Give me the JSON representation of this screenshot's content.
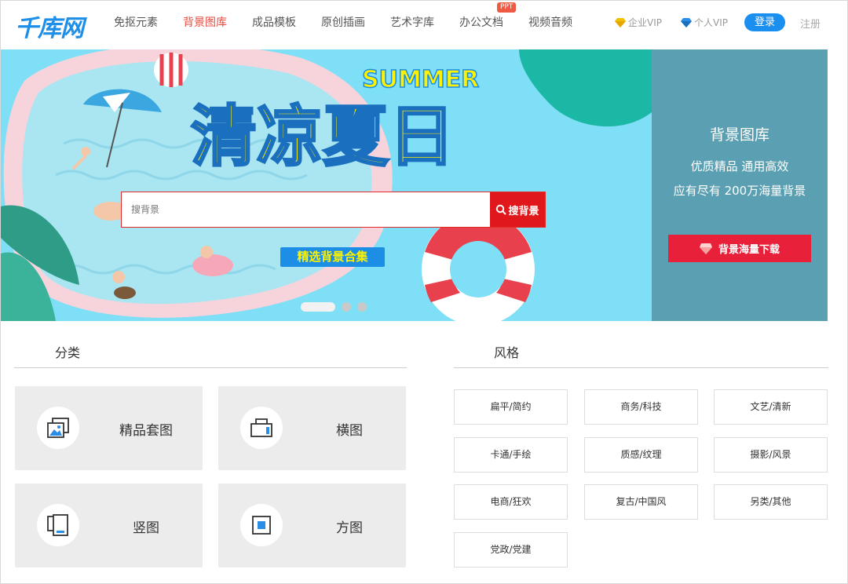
{
  "header": {
    "logo": "千库网",
    "nav": [
      {
        "label": "免抠元素",
        "active": false
      },
      {
        "label": "背景图库",
        "active": true
      },
      {
        "label": "成品模板",
        "active": false
      },
      {
        "label": "原创插画",
        "active": false
      },
      {
        "label": "艺术字库",
        "active": false
      },
      {
        "label": "办公文档",
        "active": false,
        "badge": "PPT"
      },
      {
        "label": "视频音频",
        "active": false
      }
    ],
    "enterprise_vip": "企业VIP",
    "personal_vip": "个人VIP",
    "login": "登录",
    "register": "注册"
  },
  "banner": {
    "summer_text": "SUMMER",
    "headline": "清凉夏日",
    "search_placeholder": "搜背景",
    "search_button": "搜背景",
    "collection_tag": "精选背景合集",
    "slide_count": 3,
    "active_slide": 1
  },
  "side_panel": {
    "title": "背景图库",
    "line1": "优质精品 通用高效",
    "line2": "应有尽有 200万海量背景",
    "download_button": "背景海量下载"
  },
  "categories": {
    "title": "分类",
    "items": [
      {
        "label": "精品套图",
        "icon": "image-set-icon"
      },
      {
        "label": "横图",
        "icon": "landscape-icon"
      },
      {
        "label": "竖图",
        "icon": "portrait-icon"
      },
      {
        "label": "方图",
        "icon": "square-icon"
      }
    ]
  },
  "styles": {
    "title": "风格",
    "items": [
      "扁平/简约",
      "商务/科技",
      "文艺/清新",
      "卡通/手绘",
      "质感/纹理",
      "摄影/风景",
      "电商/狂欢",
      "复古/中国风",
      "另类/其他",
      "党政/党建"
    ]
  },
  "colors": {
    "brand_blue": "#1e8fe8",
    "active_red": "#e94a3d",
    "search_red": "#e0171b",
    "banner_sky": "#7edff6",
    "side_panel": "#5b9fb2",
    "download_red": "#e8203a"
  }
}
